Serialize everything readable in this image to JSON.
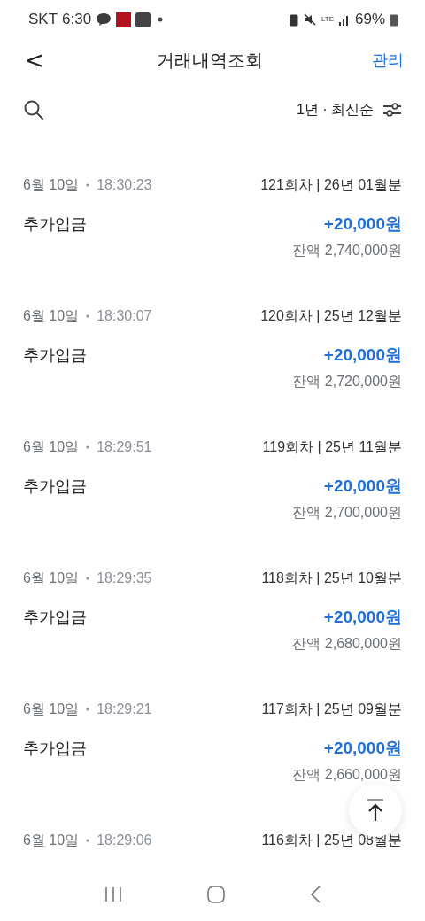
{
  "status_bar": {
    "carrier": "SKT",
    "time": "6:30",
    "network": "LTE",
    "battery": "69%"
  },
  "header": {
    "back": "<",
    "title": "거래내역조회",
    "action": "관리"
  },
  "filter": {
    "label": "1년 · 최신순"
  },
  "transactions": [
    {
      "date": "6월 10일",
      "time": "18:30:23",
      "round": "121회차 | 26년 01월분",
      "type": "추가입금",
      "amount": "+20,000원",
      "balance": "잔액 2,740,000원"
    },
    {
      "date": "6월 10일",
      "time": "18:30:07",
      "round": "120회차 | 25년 12월분",
      "type": "추가입금",
      "amount": "+20,000원",
      "balance": "잔액 2,720,000원"
    },
    {
      "date": "6월 10일",
      "time": "18:29:51",
      "round": "119회차 | 25년 11월분",
      "type": "추가입금",
      "amount": "+20,000원",
      "balance": "잔액 2,700,000원"
    },
    {
      "date": "6월 10일",
      "time": "18:29:35",
      "round": "118회차 | 25년 10월분",
      "type": "추가입금",
      "amount": "+20,000원",
      "balance": "잔액 2,680,000원"
    },
    {
      "date": "6월 10일",
      "time": "18:29:21",
      "round": "117회차 | 25년 09월분",
      "type": "추가입금",
      "amount": "+20,000원",
      "balance": "잔액 2,660,000원"
    },
    {
      "date": "6월 10일",
      "time": "18:29:06",
      "round": "116회차 | 25년 08월분"
    }
  ]
}
